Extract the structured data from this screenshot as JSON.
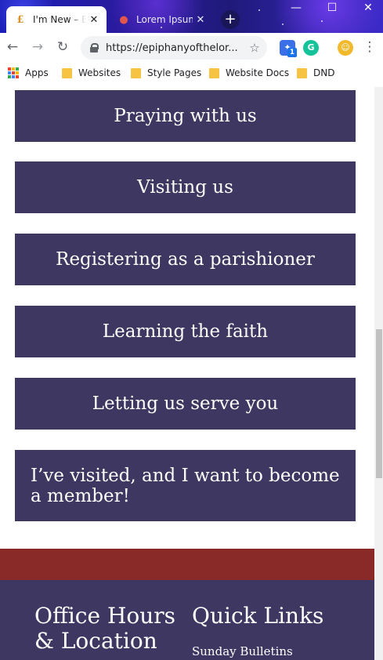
{
  "browser": {
    "tabs": [
      {
        "title": "I'm New – Epiphany",
        "active": true,
        "favicon": "epiphany-e-icon"
      },
      {
        "title": "Lorem Ipsum",
        "active": false,
        "favicon": "lorem-ipsum-icon"
      }
    ],
    "new_tab_symbol": "+",
    "window_controls": {
      "minimize": "—",
      "maximize": "☐",
      "close": "✕"
    },
    "url": "https://epiphanyofthelor...",
    "bookmarks": [
      "Apps",
      "Websites",
      "Style Pages",
      "Website Docs",
      "DND"
    ],
    "extension_badge": "1",
    "colors": {
      "titlebar": "#1f1a9a",
      "tab_active": "#ffffff"
    }
  },
  "page": {
    "actions": [
      "Praying with us",
      "Visiting us",
      "Registering as a parishioner",
      "Learning the faith",
      "Letting us serve you",
      "I’ve visited, and I want to become a member!"
    ],
    "footer": {
      "col1_heading": "Office Hours & Location",
      "col2_heading": "Quick Links",
      "links": [
        "Sunday Bulletins"
      ]
    },
    "colors": {
      "button_bg": "#3d3761",
      "band_red": "#8a2a28",
      "footer_bg": "#3d3761"
    }
  }
}
